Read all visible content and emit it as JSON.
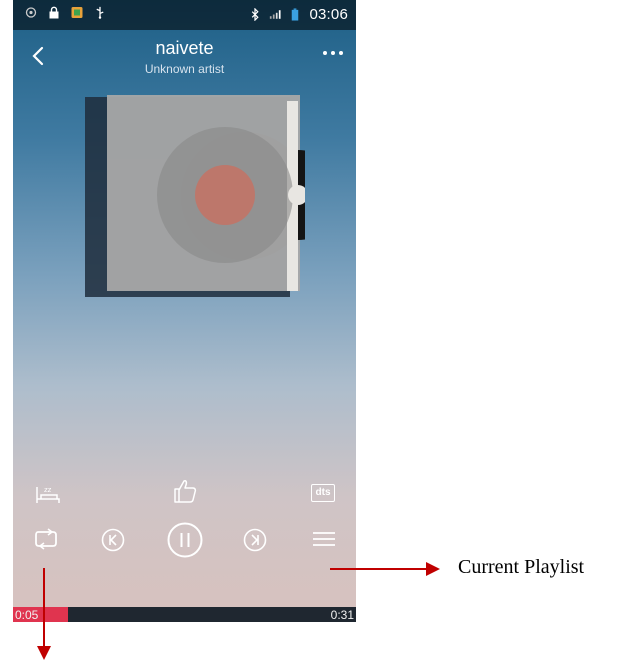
{
  "status_bar": {
    "time": "03:06"
  },
  "track": {
    "title": "naivete",
    "artist": "Unknown artist"
  },
  "playback": {
    "elapsed": "0:05",
    "total": "0:31",
    "progress_fraction": 0.16
  },
  "colors": {
    "accent": "#e0344f",
    "annotation_arrow": "#c00000"
  },
  "icons": {
    "back": "chevron-left-icon",
    "more": "more-dots-icon",
    "sleep": "sleep-timer-icon",
    "like": "thumbs-up-icon",
    "dts": "dts-icon",
    "repeat": "repeat-icon",
    "previous": "previous-icon",
    "pause": "pause-icon",
    "next": "next-icon",
    "playlist": "playlist-icon"
  },
  "labels": {
    "dts": "dts"
  },
  "annotations": {
    "playlist": "Current Playlist"
  }
}
